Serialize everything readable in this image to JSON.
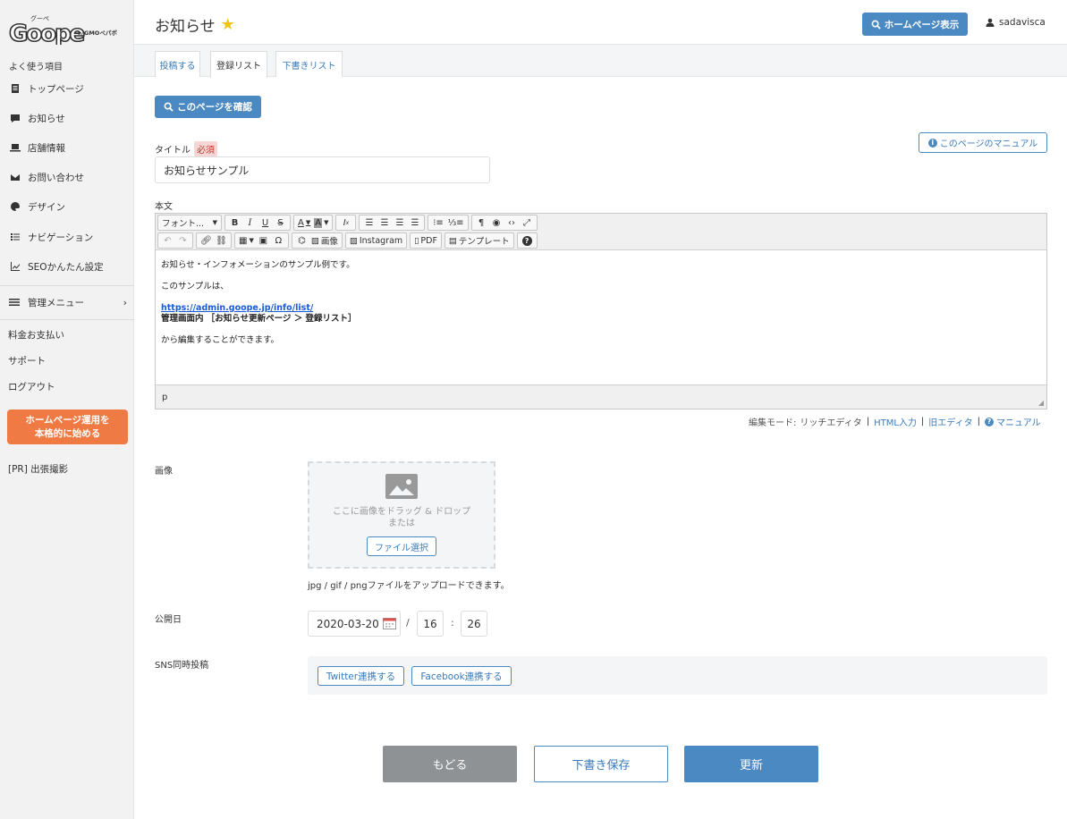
{
  "sidebar": {
    "section_label": "よく使う項目",
    "items": [
      {
        "label": "トップページ",
        "icon": "document-icon"
      },
      {
        "label": "お知らせ",
        "icon": "chat-icon"
      },
      {
        "label": "店舗情報",
        "icon": "laptop-icon"
      },
      {
        "label": "お問い合わせ",
        "icon": "mail-icon"
      },
      {
        "label": "デザイン",
        "icon": "palette-icon"
      },
      {
        "label": "ナビゲーション",
        "icon": "list-icon"
      },
      {
        "label": "SEOかんたん設定",
        "icon": "chart-icon"
      }
    ],
    "admin_menu": "管理メニュー",
    "links": [
      "料金お支払い",
      "サポート",
      "ログアウト"
    ],
    "cta_line1": "ホームページ運用を",
    "cta_line2": "本格的に始める",
    "pr": "[PR] 出張撮影"
  },
  "header": {
    "title": "お知らせ",
    "hp_button": "ホームページ表示",
    "username": "sadavisca"
  },
  "tabs": [
    {
      "label": "投稿する",
      "active": false
    },
    {
      "label": "登録リスト",
      "active": true
    },
    {
      "label": "下書きリスト",
      "active": false
    }
  ],
  "form": {
    "confirm_button": "このページを確認",
    "manual_button": "このページのマニュアル",
    "title_label": "タイトル",
    "required": "必須",
    "title_value": "お知らせサンプル",
    "body_label": "本文",
    "toolbar": {
      "font": "フォント...",
      "image": "画像",
      "instagram": "Instagram",
      "pdf": "PDF",
      "template": "テンプレート"
    },
    "content": {
      "line1": "お知らせ・インフォメーションのサンプル例です。",
      "line2": "このサンプルは、",
      "link": "https://admin.goope.jp/info/list/",
      "line3": "管理画面内 ［お知らせ更新ページ ＞ 登録リスト］",
      "line4": "から編集することができます。"
    },
    "status_path": "p",
    "mode_label": "編集モード:",
    "mode_current": "リッチエディタ",
    "mode_html": "HTML入力",
    "mode_old": "旧エディタ",
    "mode_manual": "マニュアル",
    "image_label": "画像",
    "dropzone_text1": "ここに画像をドラッグ & ドロップ",
    "dropzone_text2": "または",
    "file_button": "ファイル選択",
    "file_hint": "jpg / gif / pngファイルをアップロードできます。",
    "date_label": "公開日",
    "date_value": "2020-03-20",
    "slash": "/",
    "hour": "16",
    "colon": ":",
    "minute": "26",
    "sns_label": "SNS同時投稿",
    "twitter_button": "Twitter連携する",
    "facebook_button": "Facebook連携する"
  },
  "footer": {
    "back": "もどる",
    "draft": "下書き保存",
    "update": "更新"
  },
  "colors": {
    "primary": "#4a89c2",
    "cta": "#f07a44",
    "star": "#f0c419",
    "back_button": "#8f9295"
  }
}
